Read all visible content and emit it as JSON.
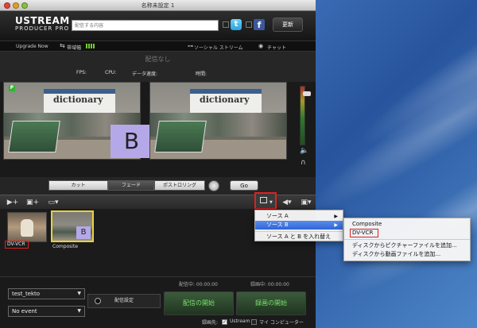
{
  "window": {
    "title": "名称未設定 1"
  },
  "header": {
    "logo_top": "USTREAM",
    "logo_bottom": "PRODUCER PRO",
    "search_placeholder": "配信する内容",
    "twitter": "t",
    "facebook": "f",
    "update_button": "更新"
  },
  "statusbar": {
    "upgrade": "Upgrade Now",
    "bandwidth": "帯域幅",
    "social_stream": "ソーシャル ストリーム",
    "chat": "チャット"
  },
  "onair": {
    "status": "配信なし",
    "fps": "FPS:",
    "cpu": "CPU:",
    "data_rate": "データ速度:",
    "time": "時間:"
  },
  "preview": {
    "banner_text": "dictionary",
    "overlay_letter": "B",
    "green_badge": "P"
  },
  "transition": {
    "cut": "カット",
    "fade": "フェード",
    "postroll": "ポストロリング",
    "go": "Go"
  },
  "sources": {
    "items": [
      {
        "label": "DV-VCR"
      },
      {
        "label": "Composite",
        "overlay": "B"
      }
    ]
  },
  "bottom": {
    "account": "test_tekto",
    "event": "No event",
    "broadcast_timer": "配信中: 00:00:00",
    "record_timer": "録画中: 00:00:00",
    "broadcast_settings": "配信設定",
    "start_broadcast": "配信の開始",
    "start_recording": "録画の開始",
    "record_dest": "録画先:",
    "dest_ustream": "Ustream",
    "dest_computer": "マイ コンピューター"
  },
  "source_menu": {
    "items": [
      {
        "label": "ソース A"
      },
      {
        "label": "ソース B"
      },
      {
        "label": "ソース A と B を入れ替え"
      }
    ]
  },
  "submenu": {
    "items": [
      {
        "label": "Composite"
      },
      {
        "label": "DV-VCR"
      },
      {
        "label": "ディスクからピクチャーファイルを追加..."
      },
      {
        "label": "ディスクから動画ファイルを追加..."
      }
    ]
  },
  "colors": {
    "accent_green": "#79e06a",
    "highlight_blue": "#2f66d8",
    "annotation_red": "#e02020"
  }
}
